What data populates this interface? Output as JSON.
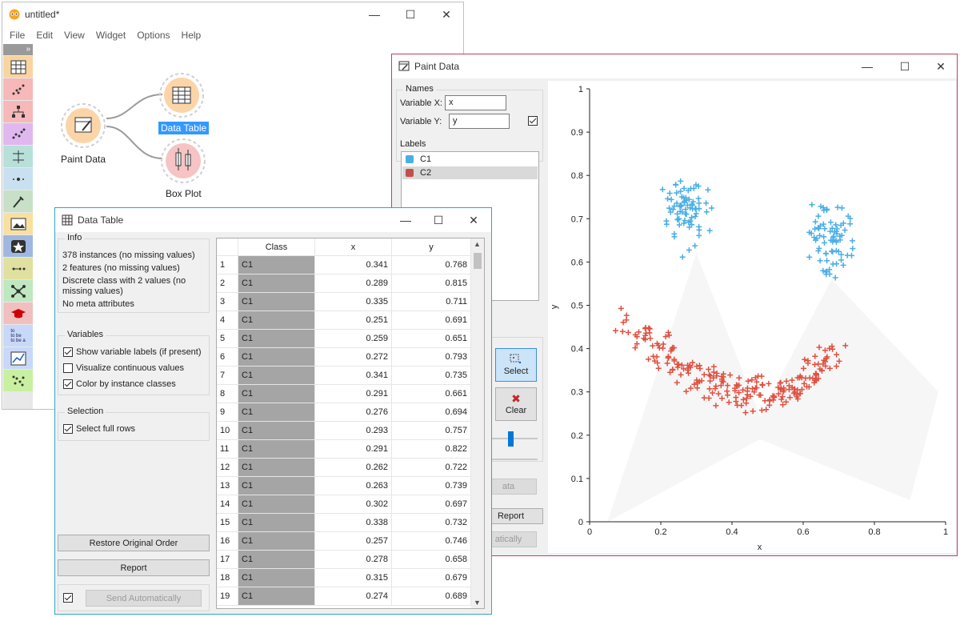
{
  "main_window": {
    "title": "untitled*",
    "menu": [
      "File",
      "Edit",
      "View",
      "Widget",
      "Options",
      "Help"
    ],
    "widgets": [
      {
        "label": "Paint Data",
        "selected": false
      },
      {
        "label": "Data Table",
        "selected": true
      },
      {
        "label": "Box Plot",
        "selected": false
      }
    ],
    "toolbox_collapse": "»"
  },
  "paint_window": {
    "title": "Paint Data",
    "names_group": "Names",
    "var_x_label": "Variable X:",
    "var_x_value": "x",
    "var_y_label": "Variable Y:",
    "var_y_value": "y",
    "labels_group": "Labels",
    "labels": [
      {
        "name": "C1",
        "color": "#4aaee6"
      },
      {
        "name": "C2",
        "color": "#c0504d"
      }
    ],
    "select_label": "Select",
    "clear_label": "Clear",
    "partial_data_label": "ata",
    "report_label": "Report",
    "partial_auto_label": "atically",
    "plot": {
      "xlabel": "x",
      "ylabel": "y",
      "xticks": [
        "0",
        "0.2",
        "0.4",
        "0.6",
        "0.8",
        "1"
      ],
      "yticks": [
        "0",
        "0.1",
        "0.2",
        "0.3",
        "0.4",
        "0.5",
        "0.6",
        "0.7",
        "0.8",
        "0.9",
        "1"
      ],
      "xlim": [
        0,
        1
      ],
      "ylim": [
        0,
        1
      ]
    }
  },
  "table_window": {
    "title": "Data Table",
    "info_group": "Info",
    "info_lines": [
      "378 instances (no missing values)",
      "2 features (no missing values)",
      "Discrete class with 2 values (no",
      "missing values)",
      "No meta attributes"
    ],
    "variables_group": "Variables",
    "var_options": [
      {
        "label": "Show variable labels (if present)",
        "checked": true
      },
      {
        "label": "Visualize continuous values",
        "checked": false
      },
      {
        "label": "Color by instance classes",
        "checked": true
      }
    ],
    "selection_group": "Selection",
    "select_full_rows": "Select full rows",
    "restore_label": "Restore Original Order",
    "report_label": "Report",
    "send_auto_label": "Send Automatically",
    "columns": [
      "",
      "Class",
      "x",
      "y"
    ],
    "rows": [
      [
        "1",
        "C1",
        "0.341",
        "0.768"
      ],
      [
        "2",
        "C1",
        "0.289",
        "0.815"
      ],
      [
        "3",
        "C1",
        "0.335",
        "0.711"
      ],
      [
        "4",
        "C1",
        "0.251",
        "0.691"
      ],
      [
        "5",
        "C1",
        "0.259",
        "0.651"
      ],
      [
        "6",
        "C1",
        "0.272",
        "0.793"
      ],
      [
        "7",
        "C1",
        "0.341",
        "0.735"
      ],
      [
        "8",
        "C1",
        "0.291",
        "0.661"
      ],
      [
        "9",
        "C1",
        "0.276",
        "0.694"
      ],
      [
        "10",
        "C1",
        "0.293",
        "0.757"
      ],
      [
        "11",
        "C1",
        "0.291",
        "0.822"
      ],
      [
        "12",
        "C1",
        "0.262",
        "0.722"
      ],
      [
        "13",
        "C1",
        "0.263",
        "0.739"
      ],
      [
        "14",
        "C1",
        "0.302",
        "0.697"
      ],
      [
        "15",
        "C1",
        "0.338",
        "0.732"
      ],
      [
        "16",
        "C1",
        "0.257",
        "0.746"
      ],
      [
        "17",
        "C1",
        "0.278",
        "0.658"
      ],
      [
        "18",
        "C1",
        "0.315",
        "0.679"
      ],
      [
        "19",
        "C1",
        "0.274",
        "0.689"
      ]
    ]
  },
  "colors": {
    "accent": "#3399ff",
    "c1": "#4aaee6",
    "c2": "#e05040",
    "widget_orange": "#fbd5a8",
    "widget_red": "#f6c4c4"
  }
}
